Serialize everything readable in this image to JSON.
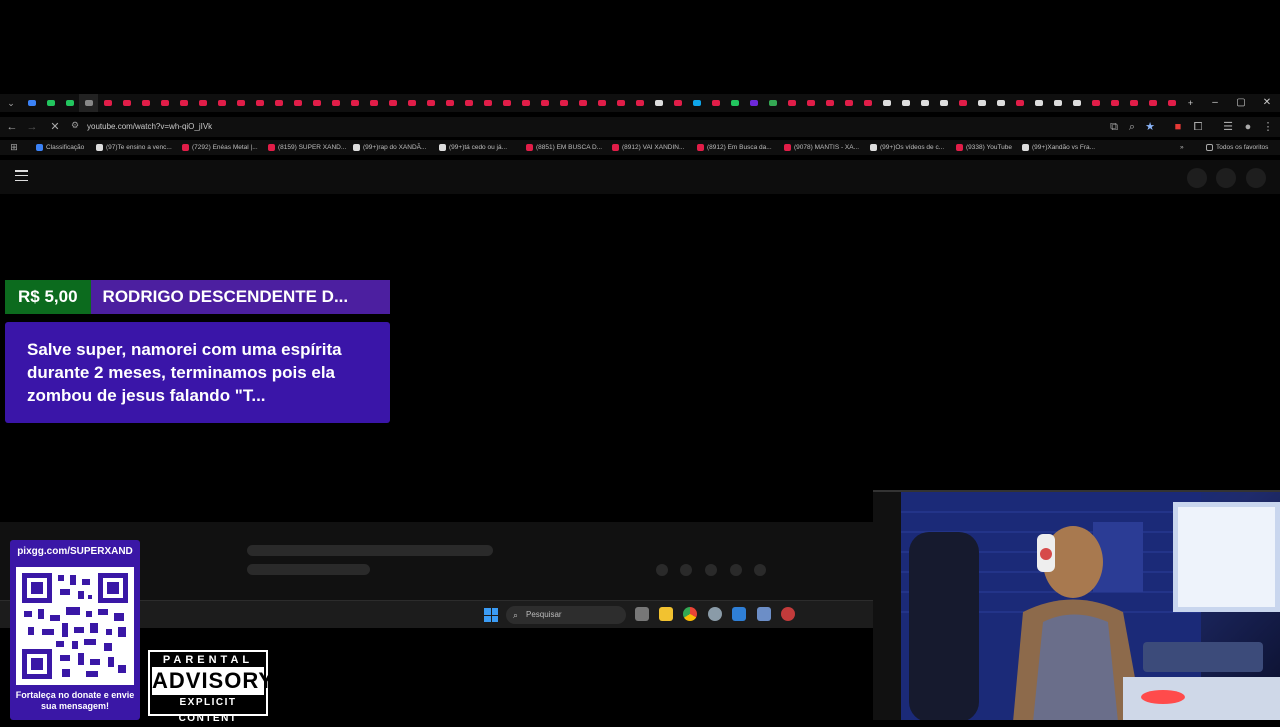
{
  "browser": {
    "url": "youtube.com/watch?v=wh-qiO_jIVk",
    "window_controls": [
      "–",
      "▢",
      "✕"
    ],
    "tab_colors": [
      "#3b82f6",
      "#22c55e",
      "#22c55e",
      "#888888",
      "#e11d48",
      "#e11d48",
      "#e11d48",
      "#e11d48",
      "#e11d48",
      "#e11d48",
      "#e11d48",
      "#e11d48",
      "#e11d48",
      "#e11d48",
      "#e11d48",
      "#e11d48",
      "#e11d48",
      "#e11d48",
      "#e11d48",
      "#e11d48",
      "#e11d48",
      "#e11d48",
      "#e11d48",
      "#e11d48",
      "#e11d48",
      "#e11d48",
      "#e11d48",
      "#e11d48",
      "#e11d48",
      "#e11d48",
      "#e11d48",
      "#e11d48",
      "#e11d48",
      "#dddddd",
      "#e11d48",
      "#0ea5e9",
      "#e11d48",
      "#22c55e",
      "#6d28d9",
      "#34a853",
      "#e11d48",
      "#e11d48",
      "#e11d48",
      "#e11d48",
      "#e11d48",
      "#dddddd",
      "#dddddd",
      "#dddddd",
      "#dddddd",
      "#e11d48",
      "#dddddd",
      "#dddddd",
      "#e11d48",
      "#dddddd",
      "#dddddd",
      "#dddddd",
      "#e11d48",
      "#e11d48",
      "#e11d48",
      "#e11d48",
      "#e11d48"
    ],
    "bookmarks": [
      {
        "label": "Classificação",
        "color": "#3b82f6"
      },
      {
        "label": "(97)Te ensino a venc...",
        "color": "#dddddd"
      },
      {
        "label": "(7292) Enéas Metal |...",
        "color": "#e11d48"
      },
      {
        "label": "(8159) SUPER XAND...",
        "color": "#e11d48"
      },
      {
        "label": "(99+)rap do XANDÃ...",
        "color": "#dddddd"
      },
      {
        "label": "(99+)tá cedo ou já...",
        "color": "#dddddd"
      },
      {
        "label": "(8851) EM BUSCA D...",
        "color": "#e11d48"
      },
      {
        "label": "(8912) VAI XANDIN...",
        "color": "#e11d48"
      },
      {
        "label": "(8912) Em Busca da...",
        "color": "#e11d48"
      },
      {
        "label": "(9078) MANTIS - XA...",
        "color": "#e11d48"
      },
      {
        "label": "(99+)Os vídeos de c...",
        "color": "#dddddd"
      },
      {
        "label": "(9338) YouTube",
        "color": "#e11d48"
      },
      {
        "label": "(99+)Xandão vs Fra...",
        "color": "#dddddd"
      }
    ],
    "all_favorites": "Todos os favoritos"
  },
  "superchat": {
    "amount": "R$ 5,00",
    "name": "RODRIGO DESCENDENTE D...",
    "message": "Salve super, namorei com uma espírita durante 2 meses, terminamos pois ela zombou de jesus falando \"T..."
  },
  "taskbar": {
    "search_placeholder": "Pesquisar"
  },
  "donate": {
    "url": "pixgg.com/SUPERXAND",
    "footer": "Fortaleça no donate e envie sua mensagem!"
  },
  "parental_advisory": {
    "top": "PARENTAL",
    "middle": "ADVISORY",
    "bottom": "EXPLICIT CONTENT"
  }
}
